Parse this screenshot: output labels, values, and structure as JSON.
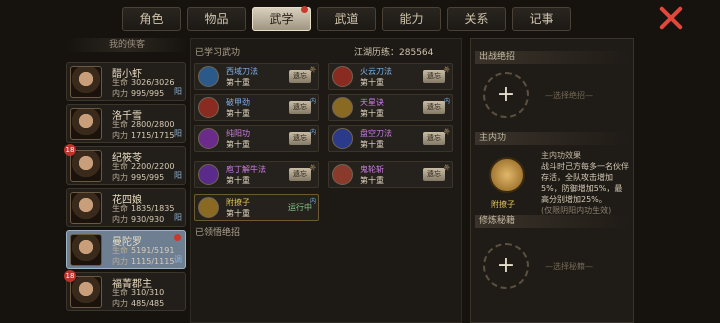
{
  "tabs": [
    {
      "label": "角色",
      "active": false
    },
    {
      "label": "物品",
      "active": false
    },
    {
      "label": "武学",
      "active": true
    },
    {
      "label": "武道",
      "active": false
    },
    {
      "label": "能力",
      "active": false
    },
    {
      "label": "关系",
      "active": false
    },
    {
      "label": "记事",
      "active": false
    }
  ],
  "left": {
    "title": "我的侠客",
    "heroes": [
      {
        "name": "醋小虾",
        "hp_label": "生命",
        "hp": "3026/3026",
        "mp_label": "内力",
        "mp": "995/995",
        "tag": "阳",
        "badge": "",
        "selected": false
      },
      {
        "name": "洛千雪",
        "hp_label": "生命",
        "hp": "2800/2800",
        "mp_label": "内力",
        "mp": "1715/1715",
        "tag": "阳",
        "badge": "",
        "selected": false
      },
      {
        "name": "纪筱苓",
        "hp_label": "生命",
        "hp": "2200/2200",
        "mp_label": "内力",
        "mp": "995/995",
        "tag": "阳",
        "badge": "18",
        "selected": false
      },
      {
        "name": "花四娘",
        "hp_label": "生命",
        "hp": "1835/1835",
        "mp_label": "内力",
        "mp": "930/930",
        "tag": "阳",
        "badge": "",
        "selected": false
      },
      {
        "name": "曼陀罗",
        "hp_label": "生命",
        "hp": "5191/5191",
        "mp_label": "内力",
        "mp": "1115/1115",
        "tag": "调",
        "badge": "",
        "selected": true
      },
      {
        "name": "福菁郡主",
        "hp_label": "生命",
        "hp": "310/310",
        "mp_label": "内力",
        "mp": "485/485",
        "tag": "",
        "badge": "18",
        "selected": false
      }
    ]
  },
  "middle": {
    "learned_title": "已学习武功",
    "exp_label": "江湖历练：",
    "exp_value": "285564",
    "mastered_title": "已领悟绝招",
    "skills": [
      {
        "name": "西域刀法",
        "level": "第十重",
        "kind": "外",
        "button": "遗忘",
        "name_color": "#7fb2e8",
        "icon_color": "#2b5a8a"
      },
      {
        "name": "火云刀法",
        "level": "第十重",
        "kind": "外",
        "button": "遗忘",
        "name_color": "#7fb2e8",
        "icon_color": "#8a2b22"
      },
      {
        "name": "破甲劲",
        "level": "第十重",
        "kind": "内",
        "button": "遗忘",
        "name_color": "#7fb2e8",
        "icon_color": "#8a2b22"
      },
      {
        "name": "天星诀",
        "level": "第十重",
        "kind": "内",
        "button": "遗忘",
        "name_color": "#d07ee8",
        "icon_color": "#8a6a22"
      },
      {
        "name": "纯阳功",
        "level": "第十重",
        "kind": "内",
        "button": "遗忘",
        "name_color": "#d07ee8",
        "icon_color": "#6a2b8a"
      },
      {
        "name": "盘空刀法",
        "level": "第十重",
        "kind": "外",
        "button": "遗忘",
        "name_color": "#d07ee8",
        "icon_color": "#2b3a8a"
      },
      {
        "name": "庖丁解牛法",
        "level": "第十重",
        "kind": "外",
        "button": "遗忘",
        "name_color": "#d07ee8",
        "icon_color": "#5a2b8a"
      },
      {
        "name": "鬼轮斩",
        "level": "第十重",
        "kind": "外",
        "button": "遗忘",
        "name_color": "#d07ee8",
        "icon_color": "#8a3a2b"
      },
      {
        "name": "附撩子",
        "level": "第十重",
        "kind": "内",
        "button": "",
        "running": "运行中",
        "name_color": "#e0c25a",
        "icon_color": "#8a6a22"
      }
    ]
  },
  "right": {
    "out_title": "出战绝招",
    "out_hint": "—选择绝招—",
    "inner_title": "主内功",
    "inner_effect_title": "主内功效果",
    "inner_desc": "战斗时己方每多一名伙伴存活，全队攻击增加5%，防御增加5%，最高分别增加25%。",
    "inner_desc_tail": "(仅限阴阳内功生效)",
    "inner_name": "附撩子",
    "secret_title": "修炼秘籍",
    "secret_hint": "—选择秘籍—"
  }
}
